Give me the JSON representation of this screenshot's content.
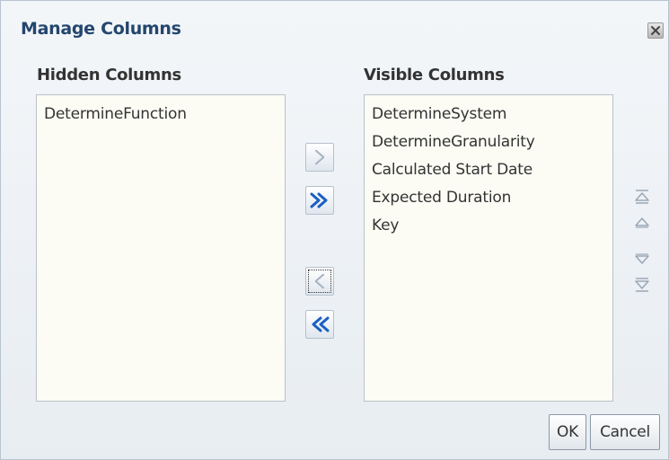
{
  "dialog": {
    "title": "Manage Columns",
    "close_icon": "close-icon"
  },
  "hidden": {
    "heading": "Hidden Columns",
    "items": [
      "DetermineFunction"
    ]
  },
  "visible": {
    "heading": "Visible Columns",
    "items": [
      "DetermineSystem",
      "DetermineGranularity",
      "Calculated Start Date",
      "Expected Duration",
      "Key"
    ]
  },
  "shuttle": {
    "move_icon": "chevron-right-icon",
    "move_all_icon": "double-chevron-right-icon",
    "remove_icon": "chevron-left-icon",
    "remove_all_icon": "double-chevron-left-icon"
  },
  "reorder": {
    "top_icon": "move-top-icon",
    "up_icon": "move-up-icon",
    "down_icon": "move-down-icon",
    "bottom_icon": "move-bottom-icon"
  },
  "footer": {
    "ok_label": "OK",
    "cancel_label": "Cancel"
  },
  "colors": {
    "title": "#24466e",
    "list_background": "#fcfcf4",
    "arrow_active": "#1b5fc2",
    "arrow_disabled": "#9ba7b5"
  }
}
